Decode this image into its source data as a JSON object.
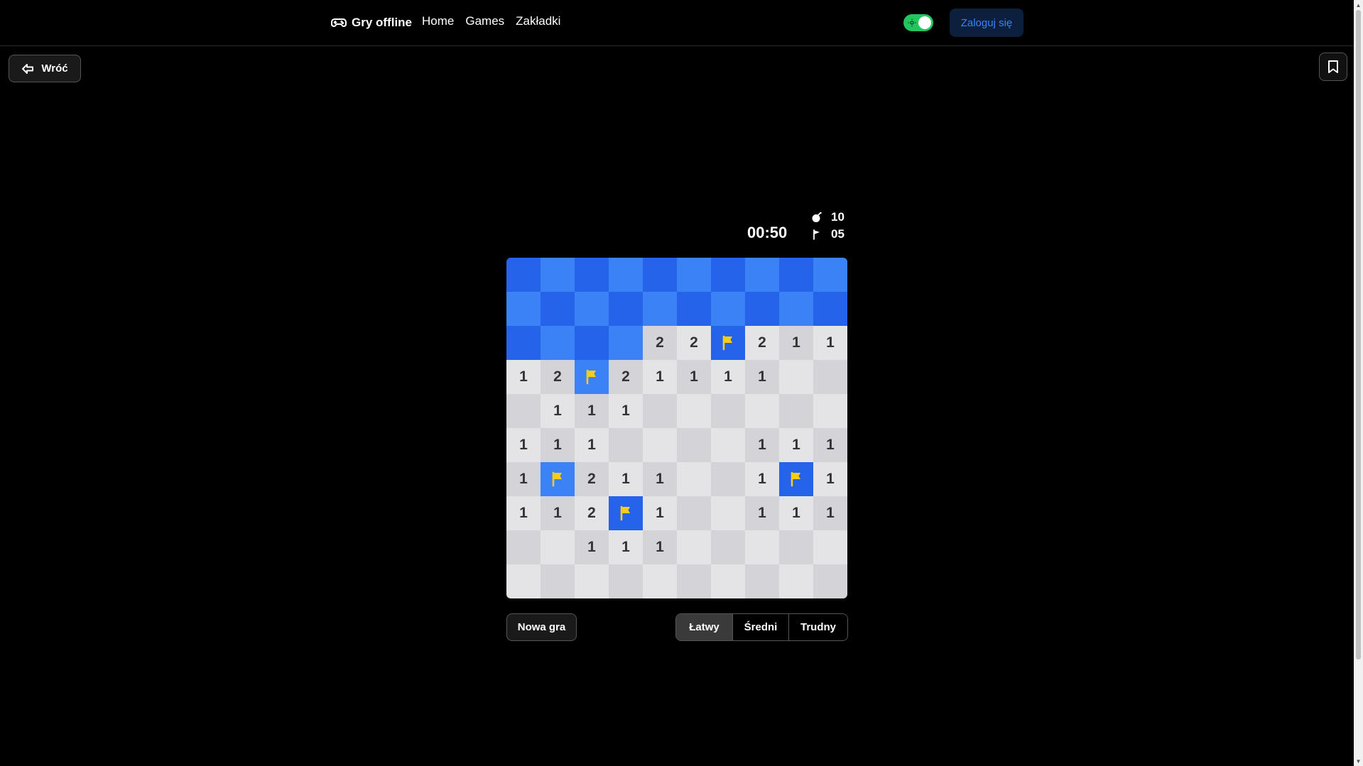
{
  "header": {
    "brand": "Gry offline",
    "nav": [
      "Home",
      "Games",
      "Zakładki"
    ],
    "theme_toggle": "on",
    "login_label": "Zaloguj się"
  },
  "back_label": "Wróć",
  "status": {
    "timer": "00:50",
    "mines": "10",
    "flags": "05"
  },
  "board": {
    "rows": 10,
    "cols": 10,
    "legend": "U = covered, F = flagged, 0 = open empty, digits = adjacent mines",
    "cells": [
      [
        "U",
        "U",
        "U",
        "U",
        "U",
        "U",
        "U",
        "U",
        "U",
        "U"
      ],
      [
        "U",
        "U",
        "U",
        "U",
        "U",
        "U",
        "U",
        "U",
        "U",
        "U"
      ],
      [
        "U",
        "U",
        "U",
        "U",
        "2",
        "2",
        "F",
        "2",
        "1",
        "1"
      ],
      [
        "1",
        "2",
        "F",
        "2",
        "1",
        "1",
        "1",
        "1",
        "0",
        "0"
      ],
      [
        "0",
        "1",
        "1",
        "1",
        "0",
        "0",
        "0",
        "0",
        "0",
        "0"
      ],
      [
        "1",
        "1",
        "1",
        "0",
        "0",
        "0",
        "0",
        "1",
        "1",
        "1"
      ],
      [
        "1",
        "F",
        "2",
        "1",
        "1",
        "0",
        "0",
        "1",
        "F",
        "1"
      ],
      [
        "1",
        "1",
        "2",
        "F",
        "1",
        "0",
        "0",
        "1",
        "1",
        "1"
      ],
      [
        "0",
        "0",
        "1",
        "1",
        "1",
        "0",
        "0",
        "0",
        "0",
        "0"
      ],
      [
        "0",
        "0",
        "0",
        "0",
        "0",
        "0",
        "0",
        "0",
        "0",
        "0"
      ]
    ]
  },
  "controls": {
    "new_game_label": "Nowa gra",
    "difficulty_options": [
      "Łatwy",
      "Średni",
      "Trudny"
    ],
    "difficulty_selected": "Łatwy"
  },
  "colors": {
    "covered_dark": "#2563eb",
    "covered_light": "#3b82f6",
    "open_dark": "#d4d4d8",
    "open_light": "#e4e4e7",
    "flag": "#facc15",
    "toggle_on": "#22c55e",
    "login_text": "#3b82f6"
  },
  "icons": {
    "brand": "gamepad-icon",
    "back": "arrow-left-icon",
    "bookmark": "bookmark-icon",
    "mines": "bomb-icon",
    "flags": "flag-icon",
    "toggle": "sun-icon"
  }
}
